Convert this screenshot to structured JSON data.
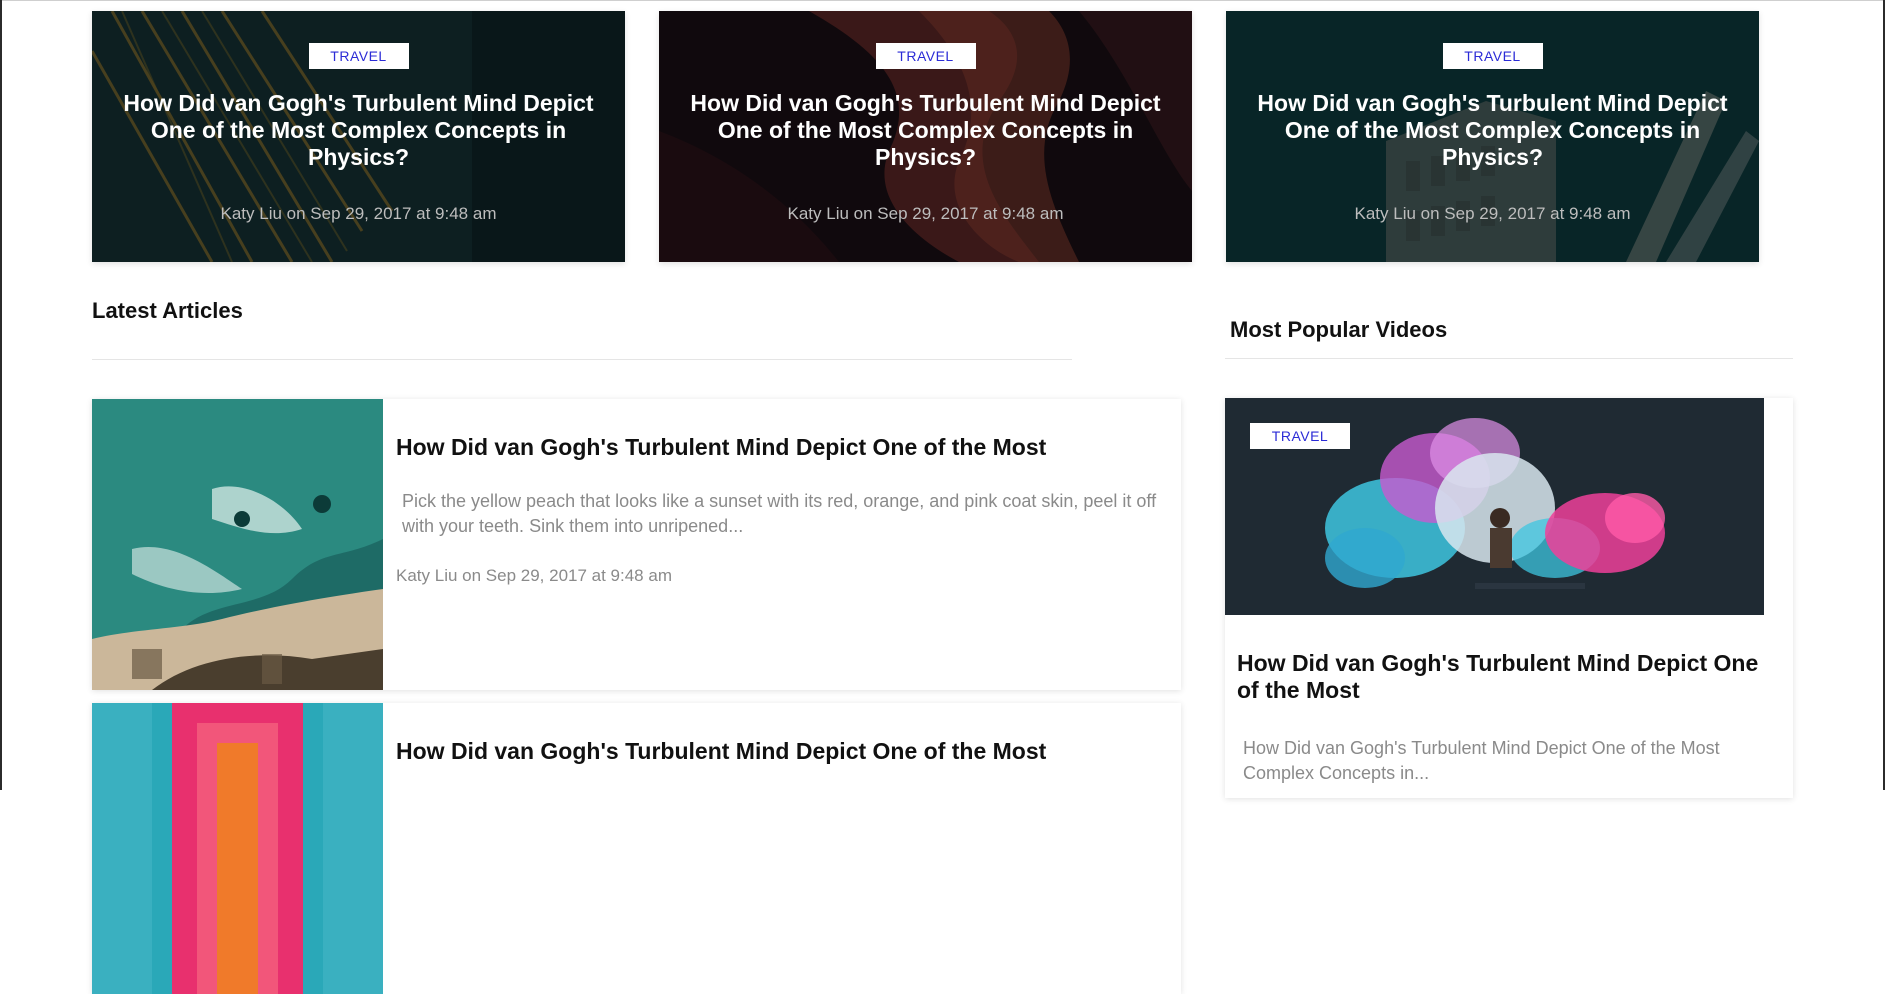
{
  "featured": [
    {
      "badge": "TRAVEL",
      "title": "How Did van Gogh's Turbulent Mind Depict One of the Most Complex Concepts in Physics?",
      "meta": "Katy Liu on Sep 29, 2017 at 9:48 am"
    },
    {
      "badge": "TRAVEL",
      "title": "How Did van Gogh's Turbulent Mind Depict One of the Most Complex Concepts in Physics?",
      "meta": "Katy Liu on Sep 29, 2017 at 9:48 am"
    },
    {
      "badge": "TRAVEL",
      "title": "How Did van Gogh's Turbulent Mind Depict One of the Most Complex Concepts in Physics?",
      "meta": "Katy Liu on Sep 29, 2017 at 9:48 am"
    }
  ],
  "latest": {
    "heading": "Latest Articles",
    "articles": [
      {
        "title": "How Did van Gogh's Turbulent Mind Depict One of the Most",
        "excerpt": "Pick the yellow peach that looks like a sunset with its red, orange, and pink coat skin, peel it off with your teeth. Sink them into unripened...",
        "meta": "Katy Liu on Sep 29, 2017 at 9:48 am"
      },
      {
        "title": "How Did van Gogh's Turbulent Mind Depict One of the Most",
        "excerpt": "",
        "meta": ""
      }
    ]
  },
  "popular": {
    "heading": "Most Popular Videos",
    "video": {
      "badge": "TRAVEL",
      "title": "How Did van Gogh's Turbulent Mind Depict One of the Most",
      "excerpt": "How Did van Gogh's Turbulent Mind Depict One of the Most Complex Concepts in..."
    }
  },
  "colors": {
    "badge_text": "#2b2bd6",
    "meta_gray": "#8a8a8a",
    "heading": "#111111"
  }
}
